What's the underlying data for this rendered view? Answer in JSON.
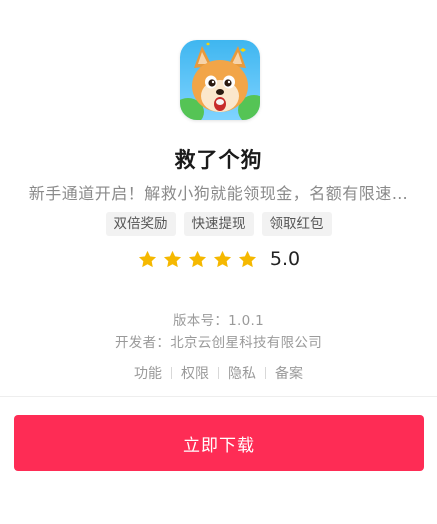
{
  "app": {
    "name": "救了个狗",
    "description": "新手通道开启！解救小狗就能领现金，名额有限速…",
    "icon": "shiba-dog-app-icon",
    "tags": [
      "双倍奖励",
      "快速提现",
      "领取红包"
    ],
    "rating": {
      "value": "5.0",
      "stars": 5,
      "star_color": "#f5b800"
    },
    "version_label": "版本号：1.0.1",
    "developer_label": "开发者：北京云创星科技有限公司"
  },
  "links": [
    "功能",
    "权限",
    "隐私",
    "备案"
  ],
  "download": {
    "label": "立即下载",
    "color": "#fe2c55"
  }
}
